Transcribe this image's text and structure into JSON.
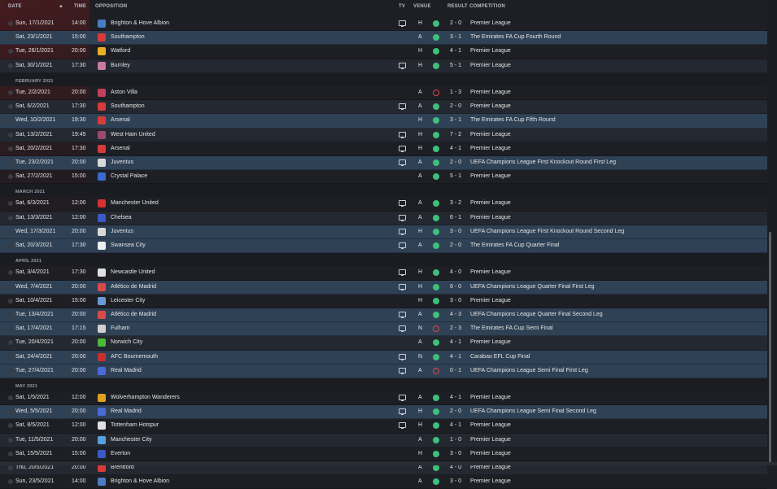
{
  "header": {
    "date": "DATE",
    "sort_indicator": "▲",
    "time": "TIME",
    "opposition": "OPPOSITION",
    "tv": "TV",
    "venue": "VENUE",
    "result": "RESULT",
    "competition": "COMPETITION"
  },
  "items": [
    {
      "kind": "row",
      "date": "Sun, 17/1/2021",
      "time": "14:00",
      "team": "Brighton & Hove Albion",
      "badge": "#4a7cc2",
      "tv": true,
      "venue": "H",
      "result": "W",
      "score": "2 - 0",
      "comp": "Premier League",
      "hl": false
    },
    {
      "kind": "row",
      "date": "Sat, 23/1/2021",
      "time": "15:00",
      "team": "Southampton",
      "badge": "#d63a3a",
      "tv": false,
      "venue": "A",
      "result": "W",
      "score": "3 - 1",
      "comp": "The Emirates FA Cup Fourth Round",
      "hl": true
    },
    {
      "kind": "row",
      "date": "Tue, 26/1/2021",
      "time": "20:00",
      "team": "Watford",
      "badge": "#e8b020",
      "tv": false,
      "venue": "H",
      "result": "W",
      "score": "4 - 1",
      "comp": "Premier League",
      "hl": false
    },
    {
      "kind": "row",
      "date": "Sat, 30/1/2021",
      "time": "17:30",
      "team": "Burnley",
      "badge": "#c97aa0",
      "tv": true,
      "venue": "H",
      "result": "W",
      "score": "5 - 1",
      "comp": "Premier League",
      "hl": false
    },
    {
      "kind": "month",
      "label": "FEBRUARY 2021"
    },
    {
      "kind": "row",
      "date": "Tue, 2/2/2021",
      "time": "20:00",
      "team": "Aston Villa",
      "badge": "#c0405a",
      "tv": false,
      "venue": "A",
      "result": "L",
      "score": "1 - 3",
      "comp": "Premier League",
      "hl": false
    },
    {
      "kind": "row",
      "date": "Sat, 6/2/2021",
      "time": "17:30",
      "team": "Southampton",
      "badge": "#d63a3a",
      "tv": true,
      "venue": "A",
      "result": "W",
      "score": "2 - 0",
      "comp": "Premier League",
      "hl": false
    },
    {
      "kind": "row",
      "date": "Wed, 10/2/2021",
      "time": "19:30",
      "team": "Arsenal",
      "badge": "#d83a3a",
      "tv": false,
      "venue": "H",
      "result": "W",
      "score": "3 - 1",
      "comp": "The Emirates FA Cup Fifth Round",
      "hl": true
    },
    {
      "kind": "row",
      "date": "Sat, 13/2/2021",
      "time": "19:45",
      "team": "West Ham United",
      "badge": "#9a4a70",
      "tv": true,
      "venue": "H",
      "result": "W",
      "score": "7 - 2",
      "comp": "Premier League",
      "hl": false
    },
    {
      "kind": "row",
      "date": "Sat, 20/2/2021",
      "time": "17:30",
      "team": "Arsenal",
      "badge": "#d83a3a",
      "tv": true,
      "venue": "H",
      "result": "W",
      "score": "4 - 1",
      "comp": "Premier League",
      "hl": false
    },
    {
      "kind": "row",
      "date": "Tue, 23/2/2021",
      "time": "20:00",
      "team": "Juventus",
      "badge": "#d8d8d8",
      "tv": true,
      "venue": "A",
      "result": "W",
      "score": "2 - 0",
      "comp": "UEFA Champions League First Knockout Round First Leg",
      "hl": true
    },
    {
      "kind": "row",
      "date": "Sat, 27/2/2021",
      "time": "15:00",
      "team": "Crystal Palace",
      "badge": "#3a6ad0",
      "tv": false,
      "venue": "A",
      "result": "W",
      "score": "5 - 1",
      "comp": "Premier League",
      "hl": false
    },
    {
      "kind": "month",
      "label": "MARCH 2021"
    },
    {
      "kind": "row",
      "date": "Sat, 6/3/2021",
      "time": "12:00",
      "team": "Manchester United",
      "badge": "#d83030",
      "tv": true,
      "venue": "A",
      "result": "W",
      "score": "3 - 2",
      "comp": "Premier League",
      "hl": false
    },
    {
      "kind": "row",
      "date": "Sat, 13/3/2021",
      "time": "12:00",
      "team": "Chelsea",
      "badge": "#3a5ac8",
      "tv": true,
      "venue": "A",
      "result": "W",
      "score": "6 - 1",
      "comp": "Premier League",
      "hl": false
    },
    {
      "kind": "row",
      "date": "Wed, 17/3/2021",
      "time": "20:00",
      "team": "Juventus",
      "badge": "#d8d8d8",
      "tv": true,
      "venue": "H",
      "result": "W",
      "score": "3 - 0",
      "comp": "UEFA Champions League First Knockout Round Second Leg",
      "hl": true
    },
    {
      "kind": "row",
      "date": "Sat, 20/3/2021",
      "time": "17:30",
      "team": "Swansea City",
      "badge": "#eeeeee",
      "tv": true,
      "venue": "A",
      "result": "W",
      "score": "2 - 0",
      "comp": "The Emirates FA Cup Quarter Final",
      "hl": true
    },
    {
      "kind": "month",
      "label": "APRIL 2021"
    },
    {
      "kind": "row",
      "date": "Sat, 3/4/2021",
      "time": "17:30",
      "team": "Newcastle United",
      "badge": "#e0e0e0",
      "tv": true,
      "venue": "H",
      "result": "W",
      "score": "4 - 0",
      "comp": "Premier League",
      "hl": false
    },
    {
      "kind": "row",
      "date": "Wed, 7/4/2021",
      "time": "20:00",
      "team": "Atlético de Madrid",
      "badge": "#d84a4a",
      "tv": true,
      "venue": "H",
      "result": "W",
      "score": "6 - 0",
      "comp": "UEFA Champions League Quarter Final First Leg",
      "hl": true
    },
    {
      "kind": "row",
      "date": "Sat, 10/4/2021",
      "time": "15:00",
      "team": "Leicester City",
      "badge": "#6a9ad8",
      "tv": false,
      "venue": "H",
      "result": "W",
      "score": "3 - 0",
      "comp": "Premier League",
      "hl": false
    },
    {
      "kind": "row",
      "date": "Tue, 13/4/2021",
      "time": "20:00",
      "team": "Atlético de Madrid",
      "badge": "#d84a4a",
      "tv": true,
      "venue": "A",
      "result": "W",
      "score": "4 - 3",
      "comp": "UEFA Champions League Quarter Final Second Leg",
      "hl": true
    },
    {
      "kind": "row",
      "date": "Sat, 17/4/2021",
      "time": "17:15",
      "team": "Fulham",
      "badge": "#d0d0d0",
      "tv": true,
      "venue": "N",
      "result": "L",
      "score": "2 - 3",
      "comp": "The Emirates FA Cup Semi Final",
      "hl": true
    },
    {
      "kind": "row",
      "date": "Tue, 20/4/2021",
      "time": "20:00",
      "team": "Norwich City",
      "badge": "#4ab838",
      "tv": false,
      "venue": "A",
      "result": "W",
      "score": "4 - 1",
      "comp": "Premier League",
      "hl": false
    },
    {
      "kind": "row",
      "date": "Sat, 24/4/2021",
      "time": "20:00",
      "team": "AFC Bournemouth",
      "badge": "#c83030",
      "tv": true,
      "venue": "N",
      "result": "W",
      "score": "4 - 1",
      "comp": "Carabao EFL Cup Final",
      "hl": true
    },
    {
      "kind": "row",
      "date": "Tue, 27/4/2021",
      "time": "20:00",
      "team": "Real Madrid",
      "badge": "#4a6ad8",
      "tv": true,
      "venue": "A",
      "result": "L",
      "score": "0 - 1",
      "comp": "UEFA Champions League Semi Final First Leg",
      "hl": true
    },
    {
      "kind": "month",
      "label": "MAY 2021"
    },
    {
      "kind": "row",
      "date": "Sat, 1/5/2021",
      "time": "12:00",
      "team": "Wolverhampton Wanderers",
      "badge": "#e0a020",
      "tv": true,
      "venue": "A",
      "result": "W",
      "score": "4 - 1",
      "comp": "Premier League",
      "hl": false
    },
    {
      "kind": "row",
      "date": "Wed, 5/5/2021",
      "time": "20:00",
      "team": "Real Madrid",
      "badge": "#4a6ad8",
      "tv": true,
      "venue": "H",
      "result": "W",
      "score": "2 - 0",
      "comp": "UEFA Champions League Semi Final Second Leg",
      "hl": true
    },
    {
      "kind": "row",
      "date": "Sat, 8/5/2021",
      "time": "12:00",
      "team": "Tottenham Hotspur",
      "badge": "#e0e0e0",
      "tv": true,
      "venue": "H",
      "result": "W",
      "score": "4 - 1",
      "comp": "Premier League",
      "hl": false
    },
    {
      "kind": "row",
      "date": "Tue, 11/5/2021",
      "time": "20:00",
      "team": "Manchester City",
      "badge": "#5aa0e0",
      "tv": false,
      "venue": "A",
      "result": "W",
      "score": "1 - 0",
      "comp": "Premier League",
      "hl": false
    },
    {
      "kind": "row",
      "date": "Sat, 15/5/2021",
      "time": "15:00",
      "team": "Everton",
      "badge": "#3a5ac8",
      "tv": false,
      "venue": "H",
      "result": "W",
      "score": "3 - 0",
      "comp": "Premier League",
      "hl": false
    },
    {
      "kind": "row",
      "date": "Thu, 20/5/2021",
      "time": "20:00",
      "team": "Brentford",
      "badge": "#d83a3a",
      "tv": false,
      "venue": "A",
      "result": "W",
      "score": "4 - 0",
      "comp": "Premier League",
      "hl": false
    },
    {
      "kind": "row",
      "date": "Sun, 23/5/2021",
      "time": "14:00",
      "team": "Brighton & Hove Albion",
      "badge": "#4a7cc2",
      "tv": false,
      "venue": "A",
      "result": "W",
      "score": "3 - 0",
      "comp": "Premier League",
      "hl": false
    }
  ]
}
